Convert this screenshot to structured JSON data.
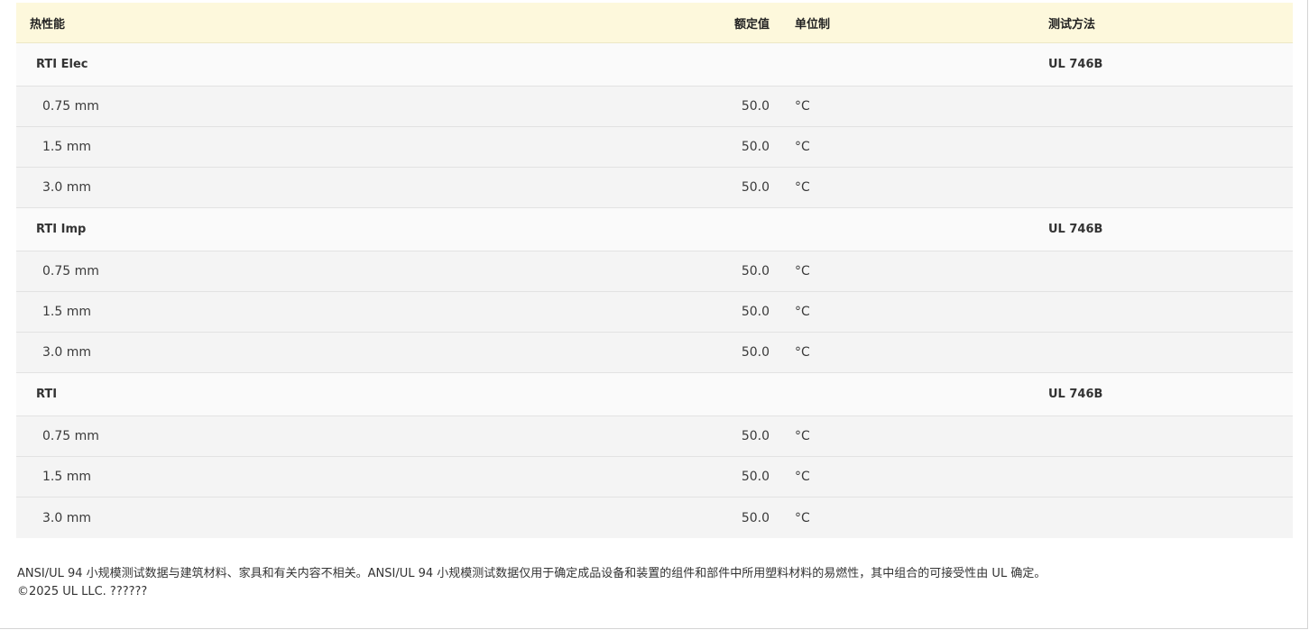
{
  "table": {
    "headers": {
      "property": "热性能",
      "value": "额定值",
      "unit": "单位制",
      "method": "测试方法"
    },
    "groups": [
      {
        "name": "RTI Elec",
        "method": "UL 746B",
        "rows": [
          {
            "thickness": "0.75 mm",
            "value": "50.0",
            "unit": "°C"
          },
          {
            "thickness": "1.5 mm",
            "value": "50.0",
            "unit": "°C"
          },
          {
            "thickness": "3.0 mm",
            "value": "50.0",
            "unit": "°C"
          }
        ]
      },
      {
        "name": "RTI Imp",
        "method": "UL 746B",
        "rows": [
          {
            "thickness": "0.75 mm",
            "value": "50.0",
            "unit": "°C"
          },
          {
            "thickness": "1.5 mm",
            "value": "50.0",
            "unit": "°C"
          },
          {
            "thickness": "3.0 mm",
            "value": "50.0",
            "unit": "°C"
          }
        ]
      },
      {
        "name": "RTI",
        "method": "UL 746B",
        "rows": [
          {
            "thickness": "0.75 mm",
            "value": "50.0",
            "unit": "°C"
          },
          {
            "thickness": "1.5 mm",
            "value": "50.0",
            "unit": "°C"
          },
          {
            "thickness": "3.0 mm",
            "value": "50.0",
            "unit": "°C"
          }
        ]
      }
    ]
  },
  "footer": {
    "disclaimer": "ANSI/UL 94 小规模测试数据与建筑材料、家具和有关内容不相关。ANSI/UL 94 小规模测试数据仅用于确定成品设备和装置的组件和部件中所用塑料材料的易燃性，其中组合的可接受性由 UL 确定。",
    "copyright": "©2025 UL LLC. ??????"
  }
}
